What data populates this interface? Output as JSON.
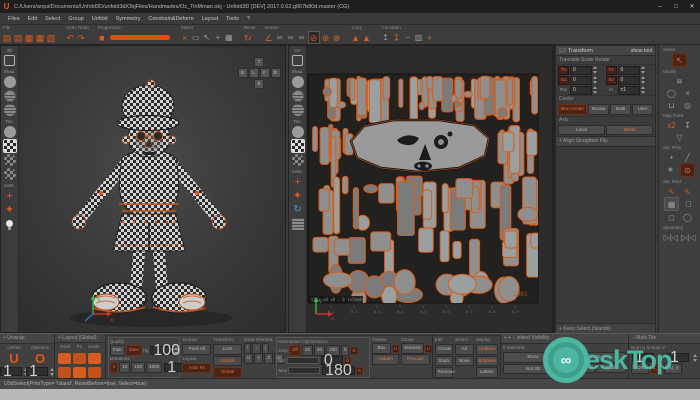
{
  "window": {
    "logo": "U",
    "title": "C:/Users/arqui/Documents/Unfold3D/unfold3d/ObjFiles/Handmades/Oz_TinMman.obj - Unfold3D [DEV] 2017.0.62.g667b80d.master (CG)",
    "minimize": "–",
    "maximize": "□",
    "close": "✕"
  },
  "menu": {
    "items": [
      "Files",
      "Edit",
      "Select",
      "Group",
      "Unfold",
      "Symmetry",
      "Constrain&Deform",
      "Layout",
      "Tools",
      "?"
    ]
  },
  "toolbar": {
    "groups": [
      {
        "label": "File",
        "icons": [
          {
            "n": "open-obj-icon",
            "g": "▤",
            "c": "o"
          },
          {
            "n": "add-obj-icon",
            "g": "▤",
            "c": "o"
          },
          {
            "n": "save-icon",
            "g": "▦",
            "c": "o"
          },
          {
            "n": "save-as-icon",
            "g": "▦",
            "c": "o"
          },
          {
            "n": "export-icon",
            "g": "▧",
            "c": "o"
          }
        ]
      },
      {
        "label": "Undo Redo",
        "icons": [
          {
            "n": "undo-icon",
            "g": "↶",
            "c": "o"
          },
          {
            "n": "redo-icon",
            "g": "↷",
            "c": "o"
          }
        ]
      },
      {
        "label": "Progression",
        "icons": [
          {
            "n": "stop-icon",
            "g": "■",
            "c": "o"
          },
          {
            "n": "progress-bar",
            "g": "",
            "c": "bar"
          }
        ]
      },
      {
        "label": "Select",
        "icons": [
          {
            "n": "delete-icon",
            "g": "×",
            "c": "o"
          },
          {
            "n": "marquee-icon",
            "g": "▭",
            "c": "g"
          },
          {
            "n": "cursor-icon",
            "g": "↖",
            "c": "g"
          },
          {
            "n": "move-cursor-icon",
            "g": "+",
            "c": "g"
          },
          {
            "n": "grid-select-icon",
            "g": "▦",
            "c": "g"
          }
        ]
      },
      {
        "label": "Reset",
        "icons": [
          {
            "n": "reset-icon",
            "g": "↻",
            "c": "o"
          }
        ]
      },
      {
        "label": "Seams",
        "icons": [
          {
            "n": "angle-seam-icon",
            "g": "∠",
            "c": "o"
          },
          {
            "n": "loop-seam-icon",
            "g": "∞",
            "c": "g"
          },
          {
            "n": "loop-seam2-icon",
            "g": "∞",
            "c": "g"
          },
          {
            "n": "loop-seam3-icon",
            "g": "∞",
            "c": "g"
          },
          {
            "n": "cut-mode-icon",
            "g": "⊘",
            "c": "ob"
          },
          {
            "n": "weld-mode-icon",
            "g": "⊕",
            "c": "o"
          },
          {
            "n": "seam-erase-icon",
            "g": "⊗",
            "c": "o"
          }
        ]
      },
      {
        "label": "Copy",
        "icons": [
          {
            "n": "copy-uv-icon",
            "g": "▲",
            "c": "o"
          },
          {
            "n": "paste-uv-icon",
            "g": "▲",
            "c": "o"
          }
        ]
      },
      {
        "label": "Constrain",
        "icons": [
          {
            "n": "pin-up-icon",
            "g": "↥",
            "c": "g"
          },
          {
            "n": "pin-down-icon",
            "g": "↧",
            "c": "o"
          },
          {
            "n": "dash-icon",
            "g": "−",
            "c": "g"
          },
          {
            "n": "tile-grid-icon",
            "g": "▥",
            "c": "g"
          },
          {
            "n": "constrain-cross-icon",
            "g": "+",
            "c": "o"
          }
        ]
      }
    ]
  },
  "vp3d": {
    "label": "3D",
    "sidebar": [
      "Shad.",
      "Tex.",
      "Cent."
    ],
    "nav": [
      "T",
      "B",
      "L",
      "F",
      "R",
      "B"
    ],
    "axis_x": "x",
    "axis_y": "y"
  },
  "uv": {
    "label": "UV",
    "sidebar": [
      "Shad.",
      "Tex.",
      "Cent."
    ],
    "tile_label": "tile u0 v0 : 0 islands",
    "udim_number": "1001",
    "axis_u": "u",
    "axis_v": "v",
    "ruler": [
      "0.1",
      "0.2",
      "0.3",
      "0.4",
      "0.5",
      "0.6",
      "0.7",
      "0.8",
      "0.9"
    ],
    "island_fill": "#8f8f8f",
    "island_fill_dark": "#7b7b7b",
    "island_fill_light": "#9aa0a0",
    "island_stroke": "#de5a12",
    "bg": "#232120",
    "seed": 20177
  },
  "transform_panel": {
    "collapse": "−",
    "title": "Transform",
    "show_tool": "show tool",
    "subtitle": "Translate Scale Rotate",
    "fields": [
      {
        "badge": "Tu",
        "value": "0"
      },
      {
        "badge": "Tv",
        "value": "0"
      },
      {
        "badge": "Su",
        "value": "0"
      },
      {
        "badge": "Sv",
        "value": "0"
      },
      {
        "badge": "Rw",
        "value": "0"
      },
      {
        "badge": "in",
        "value": "±1"
      }
    ],
    "center_label": "Center",
    "center_buttons": [
      "Box Center",
      "Mouse",
      "Multi",
      "User"
    ],
    "axis_label": "Axis",
    "axis_buttons": [
      "Local",
      "World"
    ],
    "collapsed_section": "+ Align Straighten Flip",
    "keep_select": "+ Keep Select (Islands)"
  },
  "right_toolbar": {
    "rows": [
      {
        "label": "Select"
      },
      {
        "icons": [
          {
            "n": "select-cursor-icon",
            "g": "↖",
            "cls": "o active"
          }
        ]
      },
      {
        "label": "Modify"
      },
      {
        "icons": [
          {
            "n": "brush-flag-icon",
            "g": "≋",
            "cls": ""
          }
        ]
      },
      {
        "icons": [
          {
            "n": "circle-tool-icon",
            "g": "◯",
            "cls": ""
          },
          {
            "n": "x-tool-icon",
            "g": "×",
            "cls": ""
          }
        ]
      },
      {
        "icons": [
          {
            "n": "u-shape-icon",
            "g": "⊔",
            "cls": ""
          },
          {
            "n": "o-shape-icon",
            "g": "◎",
            "cls": ""
          }
        ]
      },
      {
        "label": "Map Point"
      },
      {
        "icons": [
          {
            "n": "x2-button",
            "g": "x2",
            "cls": "o"
          },
          {
            "n": "pin-icon",
            "g": "↧",
            "cls": ""
          }
        ]
      },
      {
        "icons": [
          {
            "n": "shield-icon",
            "g": "▽",
            "cls": ""
          }
        ]
      },
      {
        "label": "Sel. Prim"
      },
      {
        "icons": [
          {
            "n": "point-prim-icon",
            "g": "•",
            "cls": ""
          },
          {
            "n": "edge-prim-icon",
            "g": "╱",
            "cls": ""
          }
        ]
      },
      {
        "icons": [
          {
            "n": "poly-prim-icon",
            "g": "∗",
            "cls": ""
          },
          {
            "n": "island-prim-icon",
            "g": "⊙",
            "cls": "o active"
          }
        ]
      },
      {
        "label": "Sel. Mod."
      },
      {
        "icons": [
          {
            "n": "wave-sel-icon",
            "g": "∿",
            "cls": "o"
          },
          {
            "n": "wave2-sel-icon",
            "g": "∿",
            "cls": "o"
          }
        ]
      },
      {
        "icons": [
          {
            "n": "checker-sel-icon",
            "g": "▦",
            "cls": "hl"
          },
          {
            "n": "bubble-sel-icon",
            "g": "◻",
            "cls": ""
          }
        ]
      },
      {
        "icons": [
          {
            "n": "box-sel-icon",
            "g": "◻",
            "cls": ""
          },
          {
            "n": "lasso-sel-icon",
            "g": "◯",
            "cls": ""
          }
        ]
      },
      {
        "label": "Symmetry"
      },
      {
        "icons": [
          {
            "n": "sym-left-icon",
            "g": "▷|◁",
            "cls": ""
          },
          {
            "n": "sym-right-icon",
            "g": "▷|◁",
            "cls": ""
          }
        ]
      }
    ]
  },
  "bottom": {
    "unwrap": {
      "header": "+ Unwrap",
      "unfold_label": "Unfold",
      "optimize_label": "Optimize",
      "unfold_glyph": "U",
      "optimize_glyph": "O",
      "unfold_value": "1",
      "optimize_value": "1"
    },
    "layout": {
      "header": "+ Layout (Global)",
      "labels": [
        "Pack",
        "Fit",
        "Scale"
      ]
    },
    "packing": {
      "header": "− Packing Properties (Global)",
      "quality_label": "Quality",
      "fast": "Fast",
      "slow": "Slow",
      "high": "High",
      "quality_value": "100",
      "mutations_label": "Mutations",
      "mutations": [
        "1",
        "10",
        "100",
        "1000"
      ],
      "mutations_value": "1",
      "groups_label": "Groups",
      "pack_all": "Pack All",
      "layout_label": "Layout",
      "auto_fit": "Auto Fit",
      "transform_label": "Transform",
      "lock": "Lock",
      "unlock": "Unlock",
      "global": "Global",
      "init_label": "Initial Orientat.",
      "init_buttons": [
        "/",
        "−",
        "|"
      ],
      "axes": [
        "U",
        "V",
        "Z",
        "M"
      ],
      "orient_label": "Orientation Optimization",
      "step_label": "Step",
      "step_options": [
        "Off",
        "45",
        "90",
        "180",
        "0"
      ],
      "min_label": "Min",
      "min_value": "0",
      "max_label": "Max",
      "max_value": "180",
      "g": "G",
      "outline_label": "Outline",
      "box": "Box",
      "hidden": "Hidden",
      "u1": "U",
      "group_label": "Group",
      "stacked": "Stacked",
      "rescale": "Rescale",
      "u2": "U"
    },
    "groups_panel": {
      "header": "− Groups",
      "edit_label": "Edit",
      "edit": [
        "Create",
        "Stack",
        "Remove"
      ],
      "select_label": "Select",
      "select": [
        "All",
        "None"
      ],
      "display_label": "Display",
      "display": [
        "Outlines",
        "B.Boxes",
        "Labels"
      ]
    },
    "island_vis": {
      "header": "+ + − Island Visibility",
      "selected": "0 Selected",
      "hidden": "0 Hidden",
      "show": "Show",
      "auto": "Auto",
      "isol3d": "Isol 3D",
      "isol": "Isol",
      "hide": "Hide"
    },
    "multitile": {
      "header": "− Multi Tile",
      "label": "Num U & Num V",
      "u": "1",
      "v": "1",
      "udim": "UDIM",
      "uv_low": "u_v",
      "uv_up": "_U_V"
    }
  },
  "status": {
    "text": "U3dSelect(PrimType= 'Island', ResetBefore=true, Select=true)"
  },
  "watermark": {
    "infinity": "∞",
    "text": "eskTop",
    "color": "#4db6a0"
  },
  "colors": {
    "accent": "#e8551a",
    "active_text": "#e8713c",
    "active_bg": "#4a2416",
    "panel": "#3f3f3f",
    "border": "#2a2a2a",
    "island_stroke": "#de5a12",
    "watermark": "#4db6a0"
  }
}
